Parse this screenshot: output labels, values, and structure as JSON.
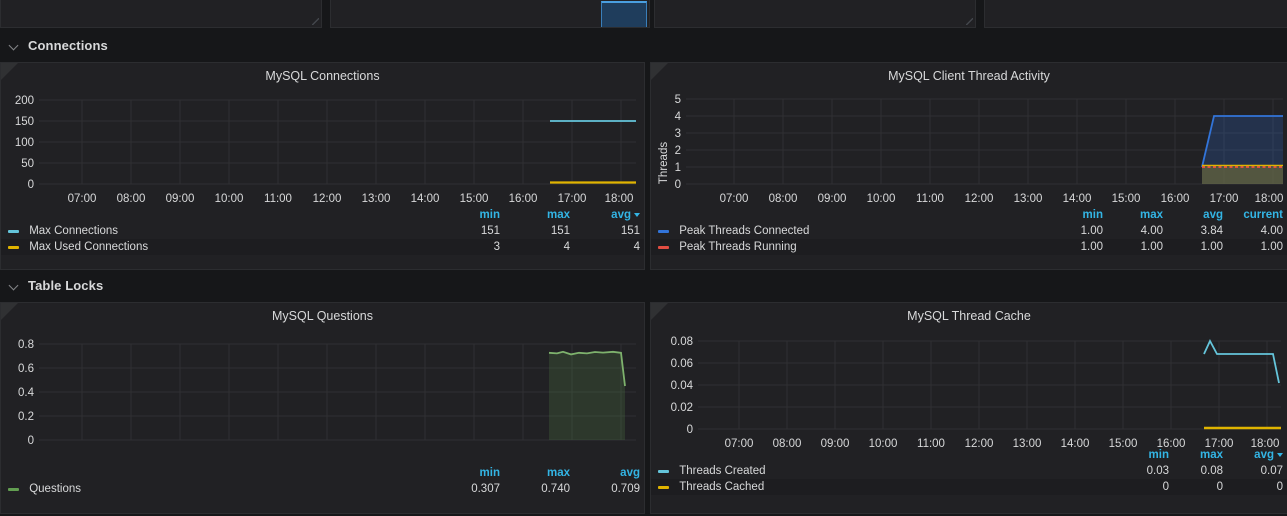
{
  "top_strip": {
    "panels": [
      {
        "name": "partial-panel-1"
      },
      {
        "name": "partial-panel-2"
      },
      {
        "name": "partial-panel-3"
      },
      {
        "name": "partial-panel-4"
      }
    ]
  },
  "rows": [
    {
      "title": "Connections",
      "chevron": "chevron-down-icon"
    },
    {
      "title": "Table Locks",
      "chevron": "chevron-down-icon"
    }
  ],
  "panels": [
    {
      "id": "mysql-connections",
      "title": "MySQL Connections",
      "info_icon": "info-icon",
      "legend_headers": [
        "min",
        "max",
        "avg"
      ],
      "sorted_column": "avg",
      "series": [
        {
          "name": "Max Connections",
          "color": "#65c5db",
          "values": [
            "151",
            "151",
            "151"
          ]
        },
        {
          "name": "Max Used Connections",
          "color": "#e0b400",
          "values": [
            "3",
            "4",
            "4"
          ]
        }
      ]
    },
    {
      "id": "mysql-client-thread-activity",
      "title": "MySQL Client Thread Activity",
      "info_icon": "info-icon",
      "ylabel": "Threads",
      "legend_headers": [
        "min",
        "max",
        "avg",
        "current"
      ],
      "sorted_column": "",
      "series": [
        {
          "name": "Peak Threads Connected",
          "color": "#3274d9",
          "values": [
            "1.00",
            "4.00",
            "3.84",
            "4.00"
          ]
        },
        {
          "name": "Peak Threads Running",
          "color": "#e24d42",
          "values": [
            "1.00",
            "1.00",
            "1.00",
            "1.00"
          ]
        }
      ]
    },
    {
      "id": "mysql-questions",
      "title": "MySQL Questions",
      "info_icon": "info-icon",
      "legend_headers": [
        "min",
        "max",
        "avg"
      ],
      "sorted_column": "",
      "series": [
        {
          "name": "Questions",
          "color": "#629e51",
          "values": [
            "0.307",
            "0.740",
            "0.709"
          ]
        }
      ]
    },
    {
      "id": "mysql-thread-cache",
      "title": "MySQL Thread Cache",
      "info_icon": "info-icon",
      "legend_headers": [
        "min",
        "max",
        "avg"
      ],
      "sorted_column": "avg",
      "series": [
        {
          "name": "Threads Created",
          "color": "#65c5db",
          "values": [
            "0.03",
            "0.08",
            "0.07"
          ]
        },
        {
          "name": "Threads Cached",
          "color": "#e0b400",
          "values": [
            "0",
            "0",
            "0"
          ]
        }
      ]
    }
  ],
  "chart_data": [
    {
      "type": "line",
      "panel": "MySQL Connections",
      "title": "MySQL Connections",
      "xlabel": "",
      "ylabel": "",
      "x_ticks": [
        "07:00",
        "08:00",
        "09:00",
        "10:00",
        "11:00",
        "12:00",
        "13:00",
        "14:00",
        "15:00",
        "16:00",
        "17:00",
        "18:00"
      ],
      "y_ticks": [
        0,
        50,
        100,
        150,
        200
      ],
      "ylim": [
        0,
        215
      ],
      "grid": true,
      "legend_position": "bottom",
      "series": [
        {
          "name": "Max Connections",
          "color": "#65c5db",
          "fill": false,
          "x": [
            "16:40",
            "17:00",
            "17:30",
            "18:00"
          ],
          "values": [
            151,
            151,
            151,
            151
          ]
        },
        {
          "name": "Max Used Connections",
          "color": "#e0b400",
          "fill": false,
          "x": [
            "16:40",
            "17:00",
            "17:30",
            "18:00"
          ],
          "values": [
            4,
            4,
            4,
            4
          ]
        }
      ]
    },
    {
      "type": "area",
      "panel": "MySQL Client Thread Activity",
      "title": "MySQL Client Thread Activity",
      "xlabel": "",
      "ylabel": "Threads",
      "x_ticks": [
        "07:00",
        "08:00",
        "09:00",
        "10:00",
        "11:00",
        "12:00",
        "13:00",
        "14:00",
        "15:00",
        "16:00",
        "17:00",
        "18:00"
      ],
      "y_ticks": [
        0,
        1,
        2,
        3,
        4,
        5
      ],
      "ylim": [
        0,
        5.4
      ],
      "grid": true,
      "legend_position": "bottom",
      "series": [
        {
          "name": "Peak Threads Connected",
          "color": "#3274d9",
          "fill": true,
          "x": [
            "16:38",
            "16:47",
            "17:00",
            "17:30",
            "18:00"
          ],
          "values": [
            1,
            4,
            4,
            4,
            4
          ]
        },
        {
          "name": "Peak Threads Running",
          "color": "#e24d42",
          "fill": true,
          "dashed": true,
          "x": [
            "16:38",
            "16:47",
            "17:00",
            "17:30",
            "18:00"
          ],
          "values": [
            1,
            1,
            1,
            1,
            1
          ]
        }
      ]
    },
    {
      "type": "area",
      "panel": "MySQL Questions",
      "title": "MySQL Questions",
      "xlabel": "",
      "ylabel": "",
      "x_ticks": [
        "07:00",
        "08:00",
        "09:00",
        "10:00",
        "11:00",
        "12:00",
        "13:00",
        "14:00",
        "15:00",
        "16:00",
        "17:00",
        "18:00"
      ],
      "y_ticks": [
        0,
        0.2,
        0.4,
        0.6,
        0.8
      ],
      "ylim": [
        0,
        0.86
      ],
      "grid": true,
      "legend_position": "bottom",
      "series": [
        {
          "name": "Questions",
          "color": "#629e51",
          "fill": true,
          "x": [
            "16:40",
            "16:50",
            "17:00",
            "17:10",
            "17:20",
            "17:30",
            "17:40",
            "17:50",
            "17:58",
            "18:00"
          ],
          "values": [
            0.735,
            0.73,
            0.74,
            0.727,
            0.735,
            0.733,
            0.74,
            0.738,
            0.735,
            0.45
          ]
        }
      ]
    },
    {
      "type": "line",
      "panel": "MySQL Thread Cache",
      "title": "MySQL Thread Cache",
      "xlabel": "",
      "ylabel": "",
      "x_ticks": [
        "07:00",
        "08:00",
        "09:00",
        "10:00",
        "11:00",
        "12:00",
        "13:00",
        "14:00",
        "15:00",
        "16:00",
        "17:00",
        "18:00"
      ],
      "y_ticks": [
        0,
        0.02,
        0.04,
        0.06,
        0.08
      ],
      "ylim": [
        0,
        0.088
      ],
      "grid": true,
      "legend_position": "bottom",
      "series": [
        {
          "name": "Threads Created",
          "color": "#65c5db",
          "fill": false,
          "x": [
            "16:40",
            "16:47",
            "16:52",
            "17:00",
            "17:45",
            "17:58",
            "18:00"
          ],
          "values": [
            0.068,
            0.08,
            0.068,
            0.068,
            0.068,
            0.068,
            0.042
          ]
        },
        {
          "name": "Threads Cached",
          "color": "#e0b400",
          "fill": false,
          "x": [
            "16:40",
            "17:00",
            "17:30",
            "18:00"
          ],
          "values": [
            0,
            0,
            0,
            0
          ]
        }
      ]
    }
  ]
}
